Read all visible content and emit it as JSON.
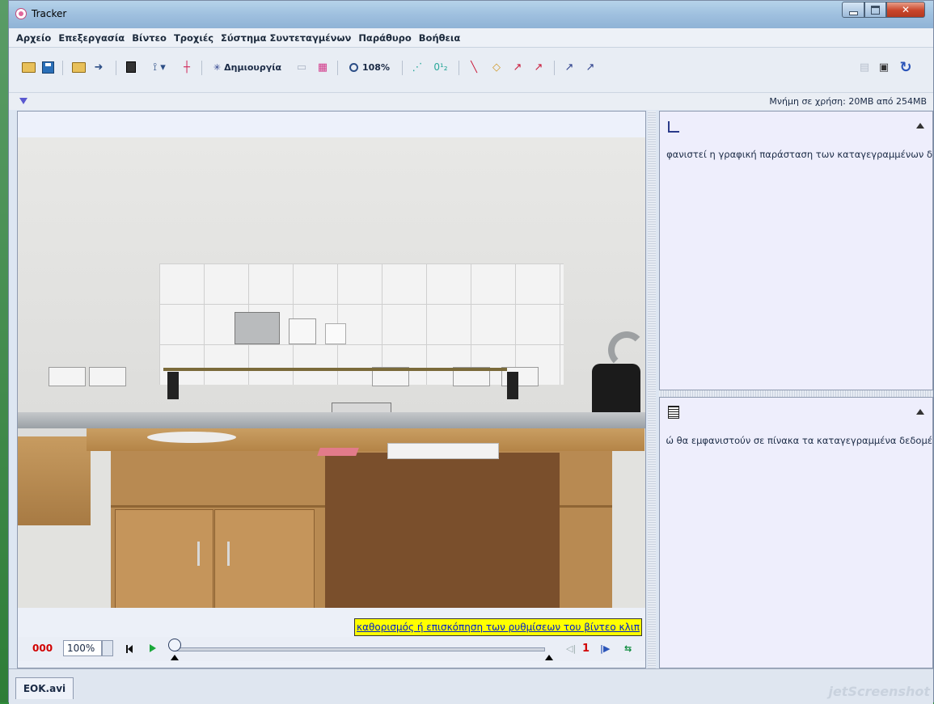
{
  "window": {
    "title": "Tracker"
  },
  "menu": [
    "Αρχείο",
    "Επεξεργασία",
    "Βίντεο",
    "Τροχιές",
    "Σύστημα Συντεταγμένων",
    "Παράθυρο",
    "Βοήθεια"
  ],
  "toolbar": {
    "create_label": "Δημιουργία",
    "zoom_label": "108%"
  },
  "status": {
    "memory": "Μνήμη σε χρήση: 20MB από 254MB"
  },
  "video": {
    "clip_note": "καθορισμός ή επισκόπηση των ρυθμίσεων του βίντεο κλιπ",
    "frame_counter": "000",
    "rate_value": "100%",
    "step_number": "1"
  },
  "graph_panel": {
    "message": "φανιστεί η γραφική παράσταση των καταγεγραμμένων δ"
  },
  "table_panel": {
    "message": "ώ θα εμφανιστούν σε πίνακα τα καταγεγραμμένα δεδομέ"
  },
  "tabs": [
    {
      "label": "EOK.avi"
    }
  ],
  "watermark": "jetScreenshot"
}
